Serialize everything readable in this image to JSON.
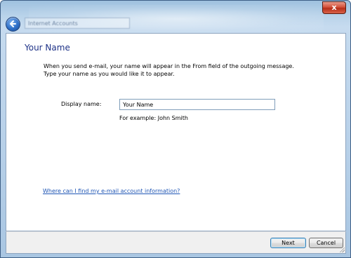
{
  "window": {
    "address_bar_text": "Internet Accounts",
    "close_label": "x"
  },
  "main": {
    "title": "Your Name",
    "intro_line1": "When you send e-mail, your name will appear in the From field of the outgoing message.",
    "intro_line2": "Type your name as you would like it to appear.",
    "display_name_label": "Display name:",
    "display_name_value": "Your Name",
    "example_text": "For example: John Smith",
    "help_link": "Where can I find my e-mail account information?"
  },
  "footer": {
    "next_label": "Next",
    "cancel_label": "Cancel"
  },
  "colors": {
    "title_blue": "#1e3287",
    "link_blue": "#1f56b5",
    "chrome_blue": "#a9c6e2"
  }
}
